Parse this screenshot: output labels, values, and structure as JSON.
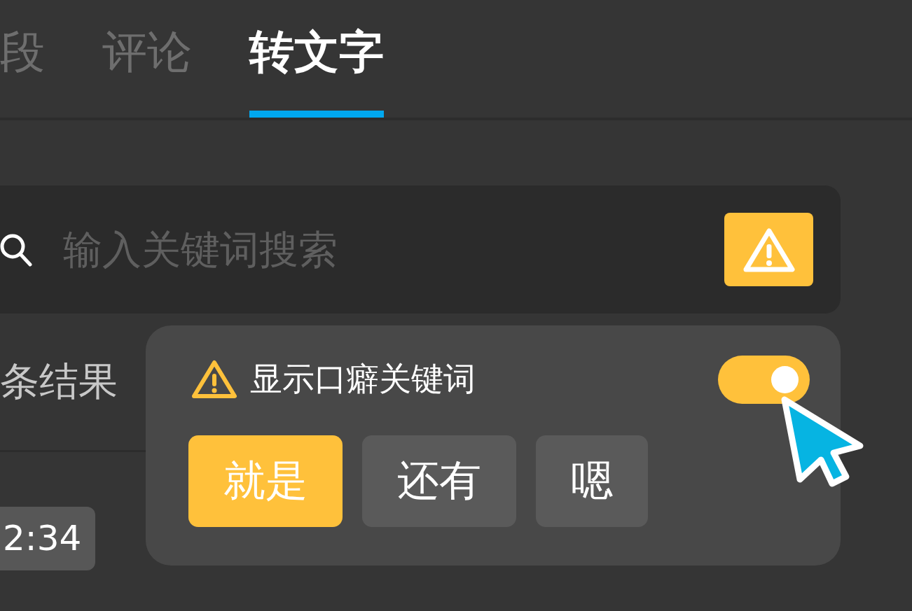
{
  "tabs": [
    {
      "label": "段",
      "selected": false
    },
    {
      "label": "评论",
      "selected": false
    },
    {
      "label": "转文字",
      "selected": true
    }
  ],
  "search": {
    "placeholder": "输入关键词搜索"
  },
  "results_label": "条结果",
  "time_badge": "2:34",
  "popup": {
    "title": "显示口癖关键词",
    "toggle": {
      "on": true
    },
    "chips": [
      {
        "label": "就是",
        "selected": true
      },
      {
        "label": "还有",
        "selected": false
      },
      {
        "label": "嗯",
        "selected": false
      }
    ]
  }
}
